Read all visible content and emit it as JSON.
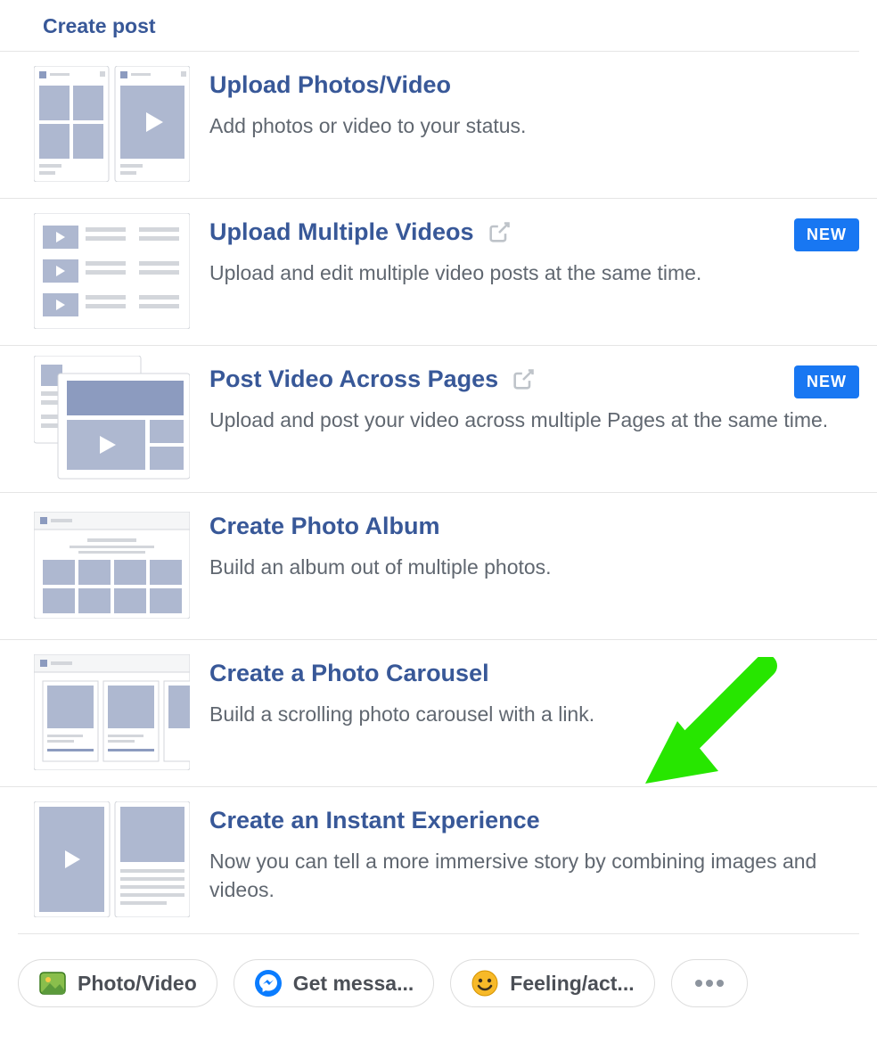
{
  "header": {
    "title": "Create post"
  },
  "options": [
    {
      "title": "Upload Photos/Video",
      "desc": "Add photos or video to your status.",
      "badge": null,
      "external": false
    },
    {
      "title": "Upload Multiple Videos",
      "desc": "Upload and edit multiple video posts at the same time.",
      "badge": "NEW",
      "external": true
    },
    {
      "title": "Post Video Across Pages",
      "desc": "Upload and post your video across multiple Pages at the same time.",
      "badge": "NEW",
      "external": true
    },
    {
      "title": "Create Photo Album",
      "desc": "Build an album out of multiple photos.",
      "badge": null,
      "external": false
    },
    {
      "title": "Create a Photo Carousel",
      "desc": "Build a scrolling photo carousel with a link.",
      "badge": null,
      "external": false,
      "annotated": true
    },
    {
      "title": "Create an Instant Experience",
      "desc": "Now you can tell a more immersive story by combining images and videos.",
      "badge": null,
      "external": false
    }
  ],
  "footer": {
    "pills": [
      {
        "label": "Photo/Video",
        "icon": "photo"
      },
      {
        "label": "Get messa...",
        "icon": "messenger"
      },
      {
        "label": "Feeling/act...",
        "icon": "smiley"
      }
    ]
  }
}
